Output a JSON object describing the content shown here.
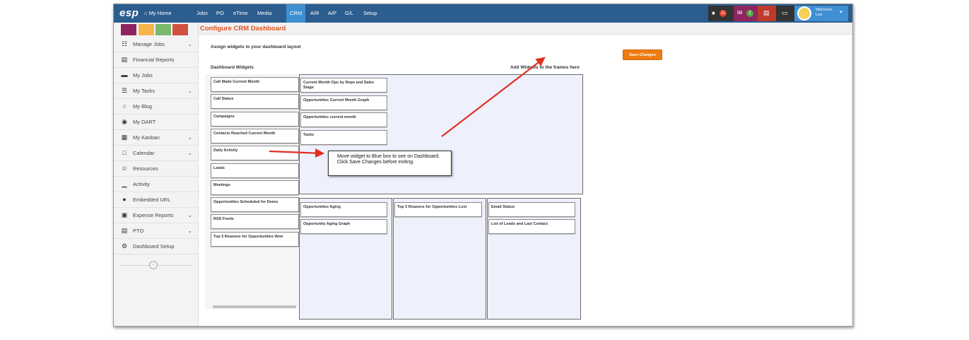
{
  "topnav": {
    "logo": "esp",
    "items": [
      "My Home",
      "Jobs",
      "PO",
      "eTime",
      "Media",
      "CRM",
      "A/R",
      "A/P",
      "G/L",
      "Setup"
    ],
    "active": "CRM",
    "notification_count": "11",
    "message_count": "2",
    "welcome_text": "Welcome,",
    "user_name": "Lea"
  },
  "sidebar": {
    "swatch_colors": [
      "#8e2460",
      "#f5b54a",
      "#79b96a",
      "#d2503f"
    ],
    "items": [
      {
        "label": "Manage Jobs",
        "icon": "sitemap-icon",
        "expandable": true
      },
      {
        "label": "Financial Reports",
        "icon": "report-icon",
        "expandable": false
      },
      {
        "label": "My Jobs",
        "icon": "folder-icon",
        "expandable": false
      },
      {
        "label": "My Tasks",
        "icon": "tasks-icon",
        "expandable": true
      },
      {
        "label": "My Blog",
        "icon": "chat-icon",
        "expandable": false
      },
      {
        "label": "My DART",
        "icon": "dart-icon",
        "expandable": false
      },
      {
        "label": "My Kanban",
        "icon": "kanban-icon",
        "expandable": true
      },
      {
        "label": "Calendar",
        "icon": "calendar-icon",
        "expandable": true
      },
      {
        "label": "Resources",
        "icon": "users-icon",
        "expandable": false
      },
      {
        "label": "Activity",
        "icon": "activity-icon",
        "expandable": false
      },
      {
        "label": "Embedded URL",
        "icon": "globe-icon",
        "expandable": false
      },
      {
        "label": "Expense Reports",
        "icon": "money-icon",
        "expandable": true
      },
      {
        "label": "PTO",
        "icon": "pto-icon",
        "expandable": true
      },
      {
        "label": "Dashboard Setup",
        "icon": "cogs-icon",
        "expandable": false
      }
    ]
  },
  "page": {
    "title": "Configure CRM Dashboard",
    "assign_text": "Assign widgets to your dashboard layout",
    "save_label": "Save Changes",
    "widgets_heading": "Dashboard Widgets",
    "frames_hint": "Add Widgets to the frames here"
  },
  "available_widgets": [
    "Call Made Current Month",
    "Call Status",
    "Campaigns",
    "Contacts Reached Current Month",
    "Daily Activity",
    "Leads",
    "Meetings",
    "Opportunities Scheduled for Demo",
    "RSS Feeds",
    "Top 5 Reasons for Opportunities Won"
  ],
  "frames": {
    "top": [
      "Current Month Ops by Reps and Sales Stage",
      "Opportunities Current Month Graph",
      "Opportunities current month",
      "Tasks"
    ],
    "bottom_left": [
      "Opportunities Aging",
      "Opportunity Aging Graph"
    ],
    "bottom_middle": [
      "Top 5 Reasons for Opportunities Lost"
    ],
    "bottom_right": [
      "Email Status",
      "List of Leads and Last Contact"
    ]
  },
  "annotation": {
    "text": "Move widget to Blue box to see on Dashboard. Click Save Changes before exiting.",
    "arrow_color": "#e0301e"
  }
}
